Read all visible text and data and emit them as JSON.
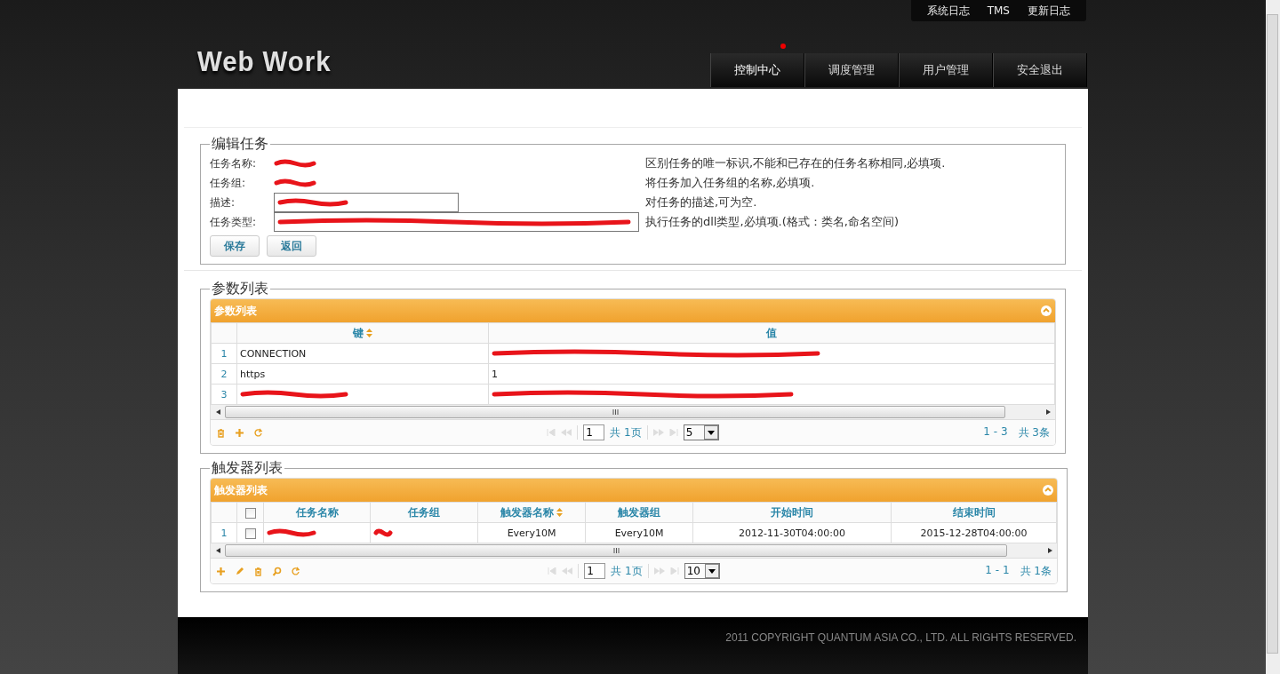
{
  "header": {
    "logo": "Web Work",
    "top_links": [
      "系统日志",
      "TMS",
      "更新日志"
    ],
    "nav": [
      {
        "label": "控制中心",
        "selected": true
      },
      {
        "label": "调度管理",
        "selected": false
      },
      {
        "label": "用户管理",
        "selected": false
      },
      {
        "label": "安全退出",
        "selected": false
      }
    ]
  },
  "edit_task": {
    "legend": "编辑任务",
    "fields": [
      {
        "label": "任务名称:",
        "kind": "text",
        "redacted": true,
        "hint": "区别任务的唯一标识,不能和已存在的任务名称相同,必填项."
      },
      {
        "label": "任务组:",
        "kind": "text",
        "redacted": true,
        "hint": "将任务加入任务组的名称,必填项."
      },
      {
        "label": "描述:",
        "kind": "input",
        "redacted": true,
        "hint": "对任务的描述,可为空."
      },
      {
        "label": "任务类型:",
        "kind": "input",
        "redacted": true,
        "hint": "执行任务的dll类型,必填项.(格式：类名,命名空间)"
      }
    ],
    "buttons": [
      "保存",
      "返回"
    ]
  },
  "params": {
    "legend": "参数列表",
    "title": "参数列表",
    "columns": [
      {
        "label": "键",
        "sorted": true
      },
      {
        "label": "值",
        "sorted": false
      }
    ],
    "rows": [
      {
        "num": "1",
        "key": "CONNECTION",
        "value_redacted": true
      },
      {
        "num": "2",
        "key": "https",
        "value": "1"
      },
      {
        "num": "3",
        "key_redacted": true,
        "value_redacted": true
      }
    ],
    "tools": [
      {
        "kind": "delete"
      },
      {
        "kind": "add"
      },
      {
        "kind": "refresh"
      }
    ],
    "pager": {
      "page": "1",
      "pages": "共 1页",
      "page_size": "5",
      "range": "1 - 3",
      "total": "共 3条"
    }
  },
  "triggers": {
    "legend": "触发器列表",
    "title": "触发器列表",
    "all_checked": false,
    "columns": [
      {
        "label": "任务名称",
        "sorted": false
      },
      {
        "label": "任务组",
        "sorted": false
      },
      {
        "label": "触发器名称",
        "sorted": true
      },
      {
        "label": "触发器组",
        "sorted": false
      },
      {
        "label": "开始时间",
        "sorted": false
      },
      {
        "label": "结束时间",
        "sorted": false
      }
    ],
    "rows": [
      {
        "num": "1",
        "checked": false,
        "cells": [
          {
            "redacted": true
          },
          {
            "redacted": true
          },
          {
            "text": "Every10M"
          },
          {
            "text": "Every10M"
          },
          {
            "text": "2012-11-30T04:00:00"
          },
          {
            "text": "2015-12-28T04:00:00"
          }
        ]
      }
    ],
    "tools": [
      {
        "kind": "add"
      },
      {
        "kind": "edit"
      },
      {
        "kind": "delete"
      },
      {
        "kind": "search"
      },
      {
        "kind": "refresh"
      }
    ],
    "pager": {
      "page": "1",
      "pages": "共 1页",
      "page_size": "10",
      "range": "1 - 1",
      "total": "共 1条"
    }
  },
  "footer": {
    "copyright": "2011 COPYRIGHT QUANTUM ASIA CO., LTD. ALL RIGHTS RESERVED."
  }
}
